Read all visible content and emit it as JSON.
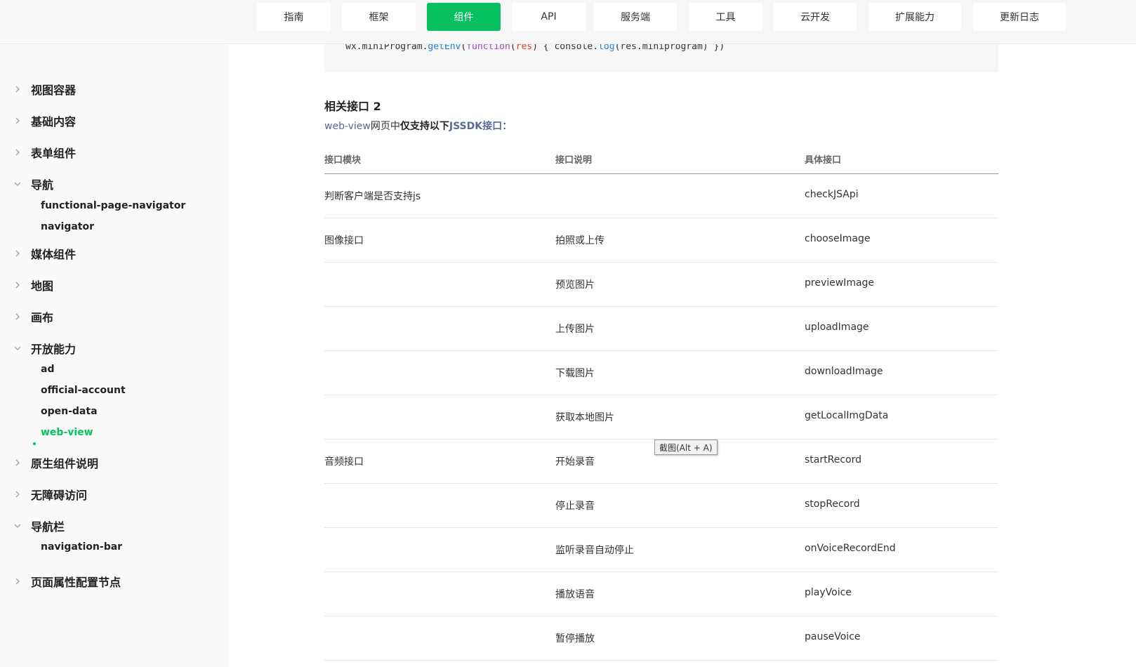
{
  "topnav": {
    "items": [
      {
        "label": "指南",
        "active": false
      },
      {
        "label": "框架",
        "active": false
      },
      {
        "label": "组件",
        "active": true
      },
      {
        "label": "API",
        "active": false
      },
      {
        "label": "服务端",
        "active": false
      },
      {
        "label": "工具",
        "active": false
      },
      {
        "label": "云开发",
        "active": false
      },
      {
        "label": "扩展能力",
        "active": false
      },
      {
        "label": "更新日志",
        "active": false
      }
    ],
    "accent_color": "#07c160"
  },
  "sidebar": {
    "groups": [
      {
        "label": "视图容器",
        "expanded": false,
        "children": []
      },
      {
        "label": "基础内容",
        "expanded": false,
        "children": []
      },
      {
        "label": "表单组件",
        "expanded": false,
        "children": []
      },
      {
        "label": "导航",
        "expanded": true,
        "children": [
          "functional-page-navigator",
          "navigator"
        ]
      },
      {
        "label": "媒体组件",
        "expanded": false,
        "children": []
      },
      {
        "label": "地图",
        "expanded": false,
        "children": []
      },
      {
        "label": "画布",
        "expanded": false,
        "children": []
      },
      {
        "label": "开放能力",
        "expanded": true,
        "children": [
          "ad",
          "official-account",
          "open-data",
          "web-view"
        ]
      },
      {
        "label": "原生组件说明",
        "expanded": false,
        "children": []
      },
      {
        "label": "无障碍访问",
        "expanded": false,
        "children": []
      },
      {
        "label": "导航栏",
        "expanded": true,
        "children": [
          "navigation-bar"
        ]
      },
      {
        "label": "页面属性配置节点",
        "expanded": false,
        "children": []
      }
    ],
    "active_item": "web-view"
  },
  "code": {
    "prefix": "wx.miniProgram.",
    "fn": "getEnv",
    "open_paren": "(",
    "keyword": "function",
    "param": "res",
    "rest": "{ console.",
    "fn2": "log",
    "tail": "(res.miniprogram) })"
  },
  "section": {
    "title": "相关接口 2",
    "intro_link": "web-view",
    "intro_text1": "网页中",
    "intro_bold": "仅支持以下",
    "intro_bold_link": "JSSDK接口",
    "intro_tail": "："
  },
  "table": {
    "headers": [
      "接口模块",
      "接口说明",
      "具体接口"
    ],
    "rows": [
      {
        "module": "判断客户端是否支持js",
        "desc": "",
        "api": "checkJSApi"
      },
      {
        "module": "图像接口",
        "desc": "拍照或上传",
        "api": "chooseImage"
      },
      {
        "module": "",
        "desc": "预览图片",
        "api": "previewImage"
      },
      {
        "module": "",
        "desc": "上传图片",
        "api": "uploadImage"
      },
      {
        "module": "",
        "desc": "下载图片",
        "api": "downloadImage"
      },
      {
        "module": "",
        "desc": "获取本地图片",
        "api": "getLocalImgData"
      },
      {
        "module": "音频接口",
        "desc": "开始录音",
        "api": "startRecord"
      },
      {
        "module": "",
        "desc": "停止录音",
        "api": "stopRecord"
      },
      {
        "module": "",
        "desc": "监听录音自动停止",
        "api": "onVoiceRecordEnd"
      },
      {
        "module": "",
        "desc": "播放语音",
        "api": "playVoice"
      },
      {
        "module": "",
        "desc": "暂停播放",
        "api": "pauseVoice"
      }
    ]
  },
  "tooltip": {
    "text": "截图(Alt + A)"
  }
}
